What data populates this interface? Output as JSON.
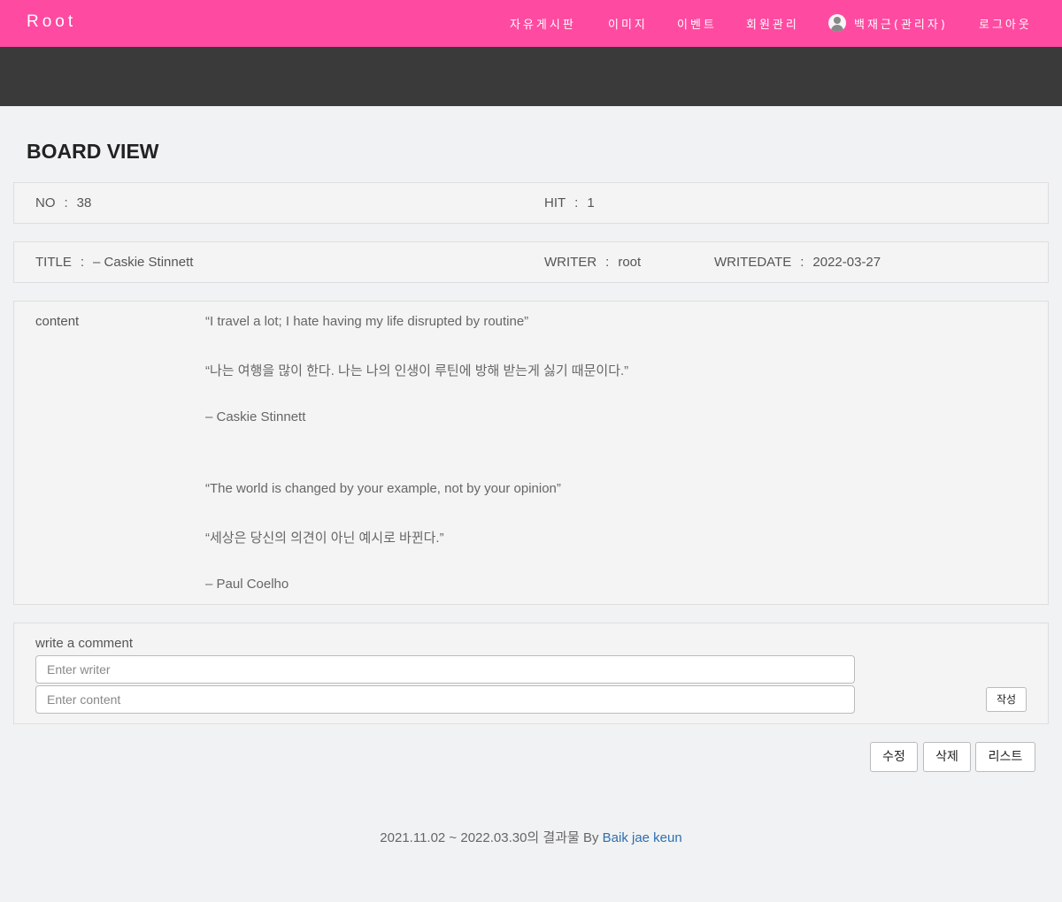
{
  "nav": {
    "brand": "Root",
    "items": [
      {
        "label": "자유게시판"
      },
      {
        "label": "이미지"
      },
      {
        "label": "이벤트"
      },
      {
        "label": "회원관리"
      },
      {
        "label": "백재근(관리자)"
      },
      {
        "label": "로그아웃"
      }
    ]
  },
  "page": {
    "title": "BOARD VIEW"
  },
  "info": {
    "no_label": "NO",
    "no_value": "38",
    "hit_label": "HIT",
    "hit_value": "1",
    "title_label": "TITLE",
    "title_value": "– Caskie Stinnett",
    "writer_label": "WRITER",
    "writer_value": "root",
    "writedate_label": "WRITEDATE",
    "writedate_value": "2022-03-27",
    "separator": ":"
  },
  "content": {
    "label": "content",
    "lines": [
      "“I travel a lot; I hate having my life disrupted by routine”",
      "“나는 여행을 많이 한다. 나는 나의 인생이 루틴에 방해 받는게 싫기 때문이다.”",
      "– Caskie Stinnett",
      "“The world is changed by your example, not by your opinion”",
      "“세상은 당신의 의견이 아닌 예시로 바뀐다.”",
      "– Paul Coelho"
    ]
  },
  "comment": {
    "heading": "write a comment",
    "writer_placeholder": "Enter writer",
    "content_placeholder": "Enter content",
    "submit_label": "작성"
  },
  "actions": {
    "edit_label": "수정",
    "delete_label": "삭제",
    "list_label": "리스트"
  },
  "footer": {
    "text": "2021.11.02 ~ 2022.03.30의 결과물 By ",
    "author": "Baik jae keun"
  },
  "colors": {
    "navbar": "#ff4aa1",
    "banner": "#3a3a3a",
    "link": "#2e6fb0"
  }
}
